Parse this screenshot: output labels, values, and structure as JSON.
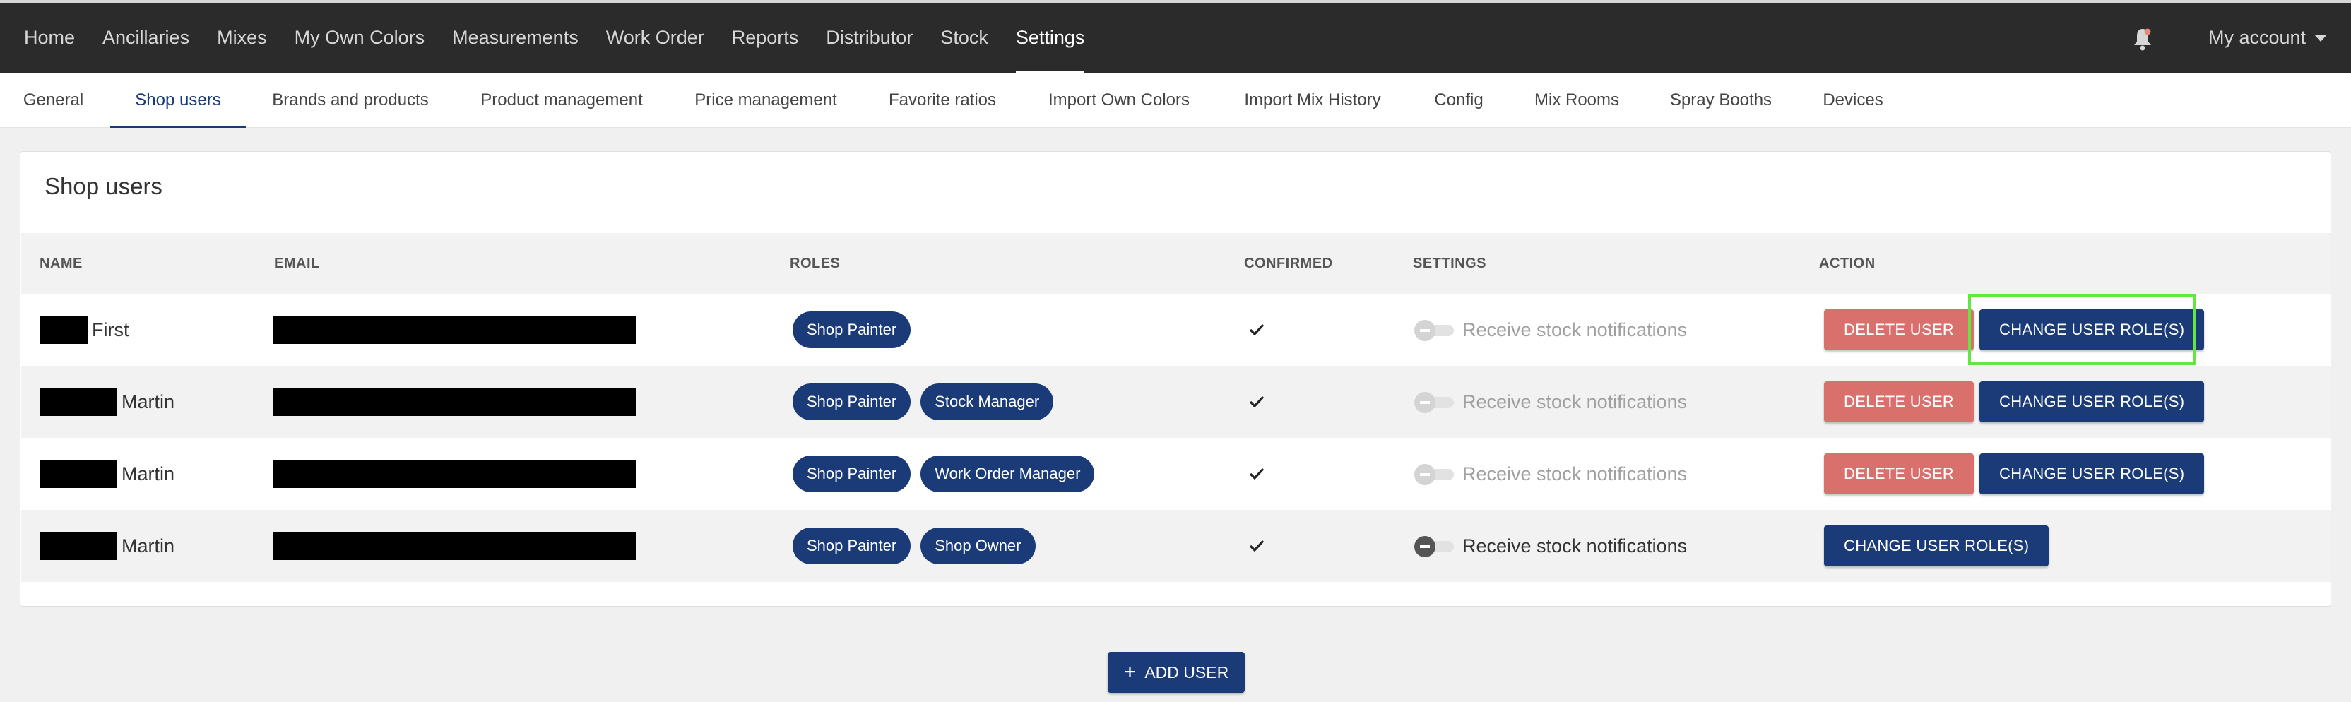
{
  "navbar": {
    "items": [
      {
        "label": "Home"
      },
      {
        "label": "Ancillaries"
      },
      {
        "label": "Mixes"
      },
      {
        "label": "My Own Colors"
      },
      {
        "label": "Measurements"
      },
      {
        "label": "Work Order"
      },
      {
        "label": "Reports"
      },
      {
        "label": "Distributor"
      },
      {
        "label": "Stock"
      },
      {
        "label": "Settings"
      }
    ],
    "active": "Settings",
    "notification_icon": "bell-icon",
    "account_label": "My account",
    "account_icon": "caret-down-icon"
  },
  "tabs": {
    "items": [
      {
        "label": "General"
      },
      {
        "label": "Shop users"
      },
      {
        "label": "Brands and products"
      },
      {
        "label": "Product management"
      },
      {
        "label": "Price management"
      },
      {
        "label": "Favorite ratios"
      },
      {
        "label": "Import Own Colors"
      },
      {
        "label": "Import Mix History"
      },
      {
        "label": "Config"
      },
      {
        "label": "Mix Rooms"
      },
      {
        "label": "Spray Booths"
      },
      {
        "label": "Devices"
      }
    ],
    "active": "Shop users"
  },
  "card": {
    "title": "Shop users",
    "columns": {
      "name": "NAME",
      "email": "EMAIL",
      "roles": "ROLES",
      "confirmed": "CONFIRMED",
      "settings": "SETTINGS",
      "action": "ACTION"
    },
    "users": [
      {
        "name": "First",
        "roles": [
          "Shop Painter"
        ],
        "confirmed": true,
        "notifications_label": "Receive stock notifications",
        "notifications_on": false,
        "delete_label": "DELETE USER",
        "change_role_label": "CHANGE USER ROLE(S)"
      },
      {
        "name": "Martin",
        "roles": [
          "Shop Painter",
          "Stock Manager"
        ],
        "confirmed": true,
        "notifications_label": "Receive stock notifications",
        "notifications_on": false,
        "delete_label": "DELETE USER",
        "change_role_label": "CHANGE USER ROLE(S)"
      },
      {
        "name": "Martin",
        "roles": [
          "Shop Painter",
          "Work Order Manager"
        ],
        "confirmed": true,
        "notifications_label": "Receive stock notifications",
        "notifications_on": false,
        "delete_label": "DELETE USER",
        "change_role_label": "CHANGE USER ROLE(S)"
      },
      {
        "name": "Martin",
        "roles": [
          "Shop Painter",
          "Shop Owner"
        ],
        "confirmed": true,
        "notifications_label": "Receive stock notifications",
        "notifications_on": true,
        "change_role_label": "CHANGE USER ROLE(S)"
      }
    ]
  },
  "add_user": {
    "icon": "plus-icon",
    "label": "ADD USER"
  },
  "colors": {
    "navbar_bg": "#2b2b2b",
    "primary": "#1a3b78",
    "delete": "#d9706b",
    "highlight": "#63e63f"
  }
}
